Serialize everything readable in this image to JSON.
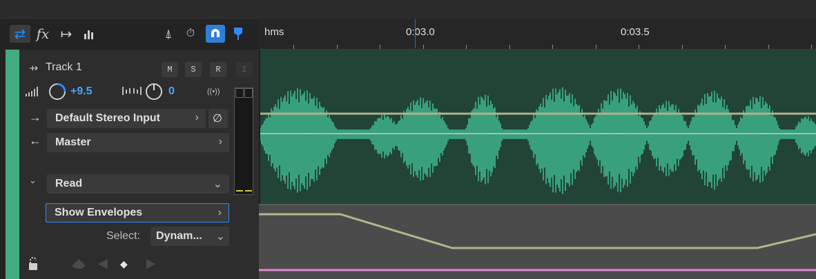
{
  "toolbar": {
    "icons": [
      "swap-arrows-icon",
      "fx-icon",
      "send-icon",
      "meter-bars-icon",
      "metronome-icon",
      "punch-timer-icon",
      "magnet-snap-icon",
      "marker-pin-icon"
    ],
    "fx_label": "fx"
  },
  "track": {
    "name": "Track 1",
    "buttons": {
      "mute": "M",
      "solo": "S",
      "record": "R",
      "input_monitor": "I"
    },
    "volume": "+9.5",
    "pan": "0",
    "stereo_label": "((•))",
    "input": "Default Stereo Input",
    "output": "Master",
    "automation_mode": "Read",
    "show_envelopes": "Show Envelopes",
    "select_label": "Select:",
    "select_value": "Dynam..."
  },
  "ruler": {
    "unit": "hms",
    "labels": [
      "0:03.0",
      "0:03.5"
    ]
  },
  "colors": {
    "track_color": "#43ad80",
    "waveform": "#43c89a",
    "clip_bg": "#224437",
    "volume_envelope": "#b3b28a",
    "pan_envelope": "#c9c9d9",
    "lane_envelope": "#b6b48e",
    "lane_pink": "#e28ad3",
    "accent_blue": "#2f8bff"
  }
}
